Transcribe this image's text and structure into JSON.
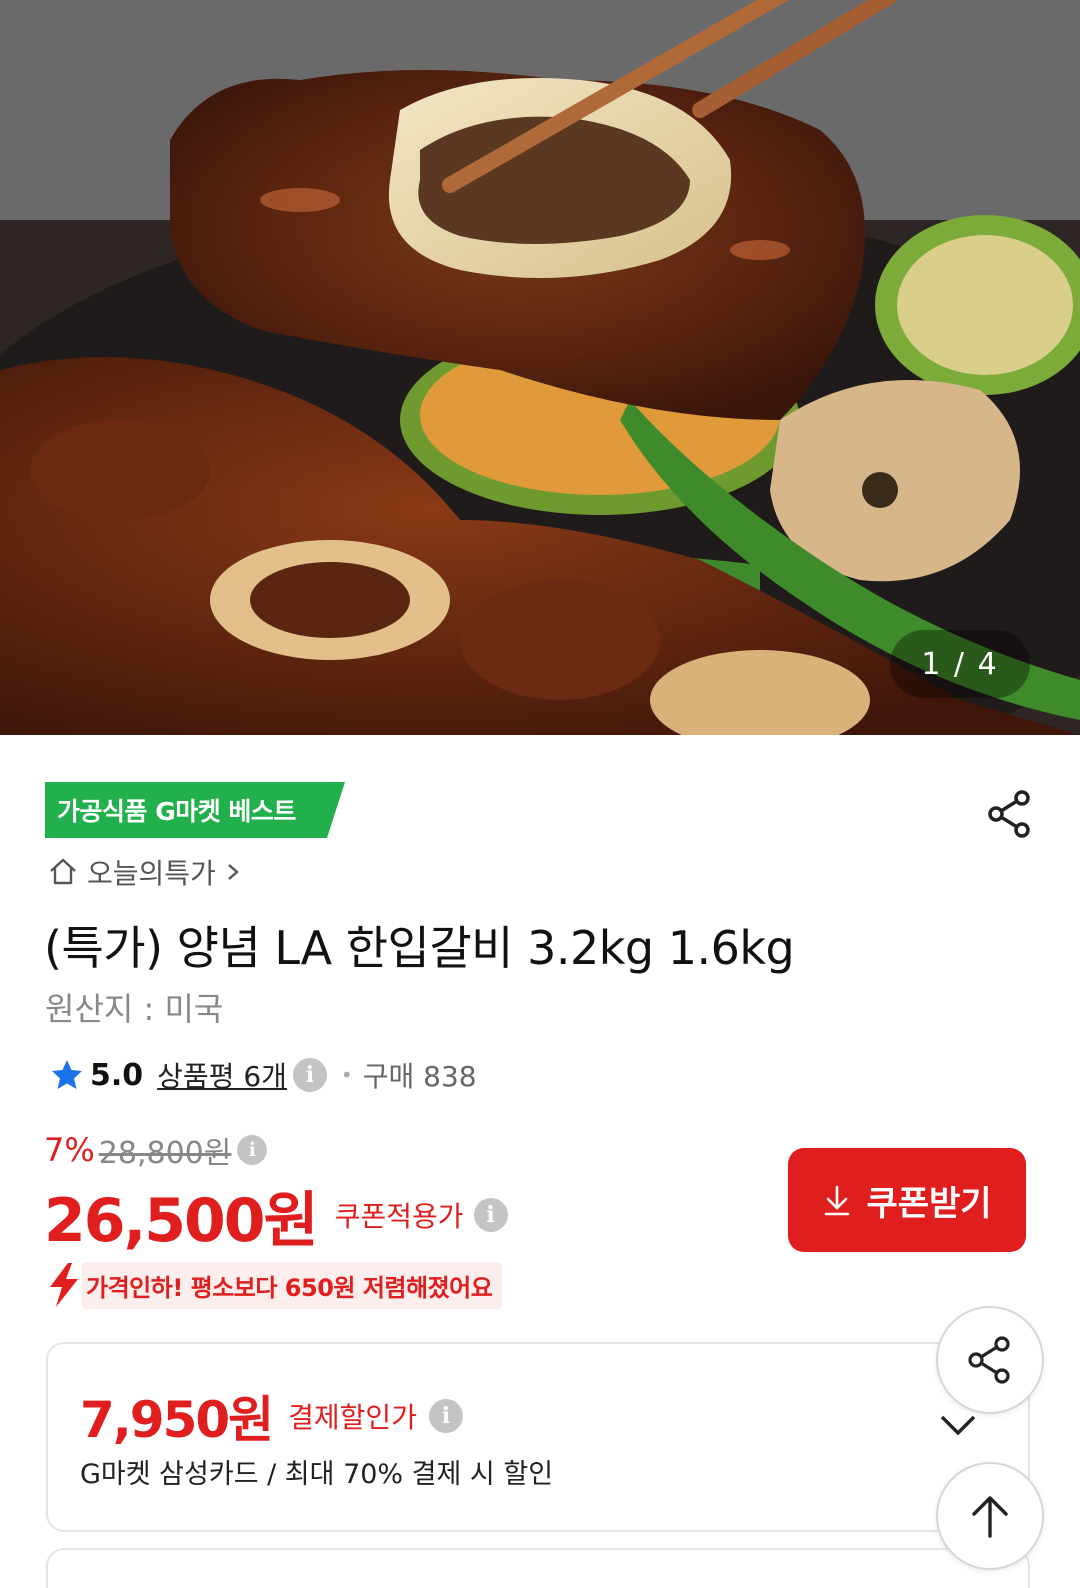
{
  "hero": {
    "page_current": "1",
    "page_total": "4",
    "page_indicator": "1 / 4"
  },
  "badge": {
    "text": "가공식품 G마켓 베스트"
  },
  "breadcrumb": {
    "label": "오늘의특가"
  },
  "product": {
    "title": "(특가) 양념 LA 한입갈비 3.2kg 1.6kg",
    "origin": "원산지 : 미국"
  },
  "rating": {
    "score": "5.0",
    "reviews": "상품평 6개",
    "purchase": "구매 838"
  },
  "price": {
    "discount_pct": "7%",
    "original": "28,800원",
    "current": "26,500원",
    "current_label": "쿠폰적용가",
    "coupon_button": "쿠폰받기",
    "price_drop_msg": "가격인하! 평소보다 650원 저렴해졌어요"
  },
  "payment": {
    "amount": "7,950원",
    "label": "결제할인가",
    "desc": "G마켓 삼성카드 / 최대 70% 결제 시 할인"
  },
  "colors": {
    "accent_red": "#e01e1e",
    "badge_green": "#21b04b",
    "star_blue": "#1a73e8"
  },
  "icons": {
    "share": "share-icon",
    "home": "home-icon",
    "star": "star-icon",
    "info": "info-icon",
    "download": "download-icon",
    "bolt": "bolt-icon",
    "chevron_down": "chevron-down-icon",
    "arrow_up": "arrow-up-icon"
  }
}
